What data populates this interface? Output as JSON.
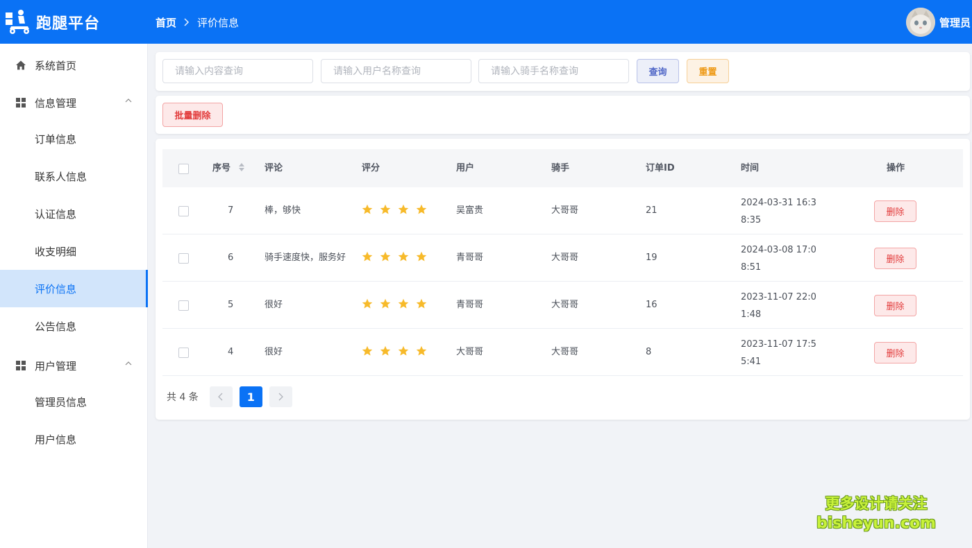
{
  "header": {
    "app_title": "跑腿平台",
    "logo_icon": "delivery-rider-icon",
    "breadcrumb": {
      "home": "首页",
      "current": "评价信息"
    },
    "user": {
      "name": "管理员",
      "avatar_icon": "cat-avatar"
    }
  },
  "sidebar": {
    "items": [
      {
        "label": "系统首页",
        "icon": "home-icon",
        "type": "top"
      },
      {
        "label": "信息管理",
        "icon": "grid-icon",
        "type": "group",
        "expanded": true
      },
      {
        "label": "订单信息",
        "type": "sub"
      },
      {
        "label": "联系人信息",
        "type": "sub"
      },
      {
        "label": "认证信息",
        "type": "sub"
      },
      {
        "label": "收支明细",
        "type": "sub"
      },
      {
        "label": "评价信息",
        "type": "sub",
        "active": true
      },
      {
        "label": "公告信息",
        "type": "sub"
      },
      {
        "label": "用户管理",
        "icon": "grid-icon",
        "type": "group",
        "expanded": true
      },
      {
        "label": "管理员信息",
        "type": "sub"
      },
      {
        "label": "用户信息",
        "type": "sub"
      }
    ]
  },
  "search": {
    "content_placeholder": "请输入内容查询",
    "user_placeholder": "请输入用户名称查询",
    "rider_placeholder": "请输入骑手名称查询",
    "query_label": "查询",
    "reset_label": "重置"
  },
  "toolbar": {
    "batch_delete_label": "批量删除"
  },
  "table": {
    "columns": [
      "序号",
      "评论",
      "评分",
      "用户",
      "骑手",
      "订单ID",
      "时间",
      "操作"
    ],
    "rows": [
      {
        "id": "7",
        "comment": "棒，够快",
        "rating": 4,
        "user": "吴富贵",
        "rider": "大哥哥",
        "order_id": "21",
        "time": "2024-03-31 16:38:35",
        "action": "删除"
      },
      {
        "id": "6",
        "comment": "骑手速度快，服务好",
        "rating": 4,
        "user": "青哥哥",
        "rider": "大哥哥",
        "order_id": "19",
        "time": "2024-03-08 17:08:51",
        "action": "删除"
      },
      {
        "id": "5",
        "comment": "很好",
        "rating": 4,
        "user": "青哥哥",
        "rider": "大哥哥",
        "order_id": "16",
        "time": "2023-11-07 22:01:48",
        "action": "删除"
      },
      {
        "id": "4",
        "comment": "很好",
        "rating": 4,
        "user": "大哥哥",
        "rider": "大哥哥",
        "order_id": "8",
        "time": "2023-11-07 17:55:41",
        "action": "删除"
      }
    ]
  },
  "pagination": {
    "total_text": "共 4 条",
    "current_page": "1"
  },
  "watermark": {
    "line1": "更多设计请关注",
    "line2": "bisheyun.com"
  },
  "colors": {
    "primary": "#0a72f5",
    "danger": "#e23b3b",
    "warning": "#ee9a17",
    "star": "#f7ba2a"
  }
}
